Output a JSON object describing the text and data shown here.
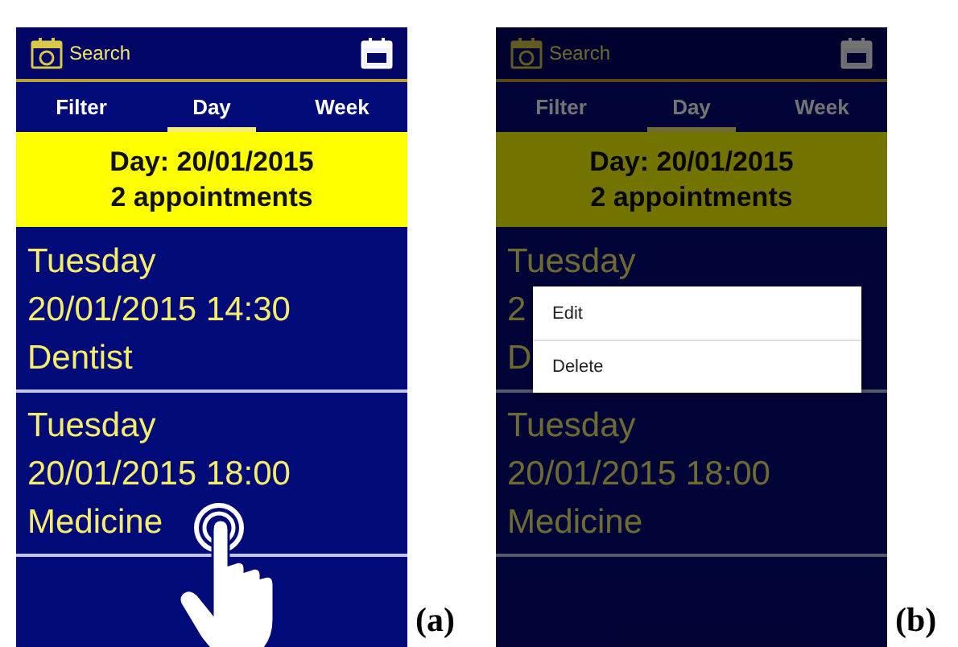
{
  "panels": [
    {
      "label": "(a)",
      "dimmed": false,
      "touch_indicator": true,
      "top_bar": {
        "search_label": "Search"
      },
      "tabs": [
        {
          "label": "Filter",
          "selected": false
        },
        {
          "label": "Day",
          "selected": true
        },
        {
          "label": "Week",
          "selected": false
        }
      ],
      "banner": {
        "title": "Day: 20/01/2015",
        "subtitle": "2 appointments"
      },
      "appointments": [
        {
          "day": "Tuesday",
          "datetime": "20/01/2015 14:30",
          "title": "Dentist"
        },
        {
          "day": "Tuesday",
          "datetime": "20/01/2015 18:00",
          "title": "Medicine"
        }
      ]
    },
    {
      "label": "(b)",
      "dimmed": true,
      "touch_indicator": false,
      "top_bar": {
        "search_label": "Search"
      },
      "tabs": [
        {
          "label": "Filter",
          "selected": false
        },
        {
          "label": "Day",
          "selected": true
        },
        {
          "label": "Week",
          "selected": false
        }
      ],
      "banner": {
        "title": "Day: 20/01/2015",
        "subtitle": "2 appointments"
      },
      "appointments": [
        {
          "day": "Tuesday",
          "datetime": "2",
          "title": "D"
        },
        {
          "day": "Tuesday",
          "datetime": "20/01/2015 18:00",
          "title": "Medicine"
        }
      ],
      "context_menu": {
        "items": [
          "Edit",
          "Delete"
        ]
      }
    }
  ]
}
